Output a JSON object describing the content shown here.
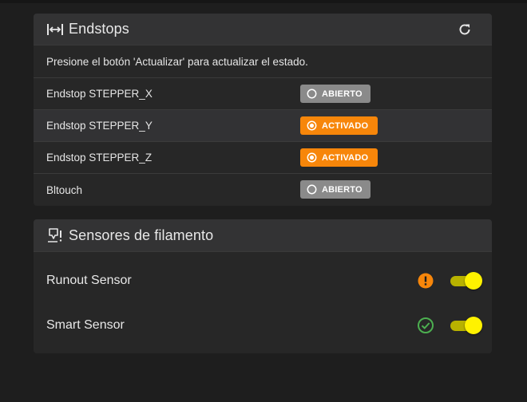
{
  "endstops": {
    "title": "Endstops",
    "info_text": "Presione el botón 'Actualizar' para actualizar el estado.",
    "items": [
      {
        "name": "Endstop STEPPER_X",
        "state": "ABIERTO"
      },
      {
        "name": "Endstop STEPPER_Y",
        "state": "ACTIVADO"
      },
      {
        "name": "Endstop STEPPER_Z",
        "state": "ACTIVADO"
      },
      {
        "name": "Bltouch",
        "state": "ABIERTO"
      }
    ]
  },
  "filament": {
    "title": "Sensores de filamento",
    "sensors": [
      {
        "name": "Runout Sensor",
        "status_icon": "alert-circle-icon",
        "enabled": true
      },
      {
        "name": "Smart Sensor",
        "status_icon": "check-circle-icon",
        "enabled": true
      }
    ]
  },
  "colors": {
    "accent": "#f7860a",
    "toggle_on": "#fff200",
    "ok": "#4caf50"
  }
}
